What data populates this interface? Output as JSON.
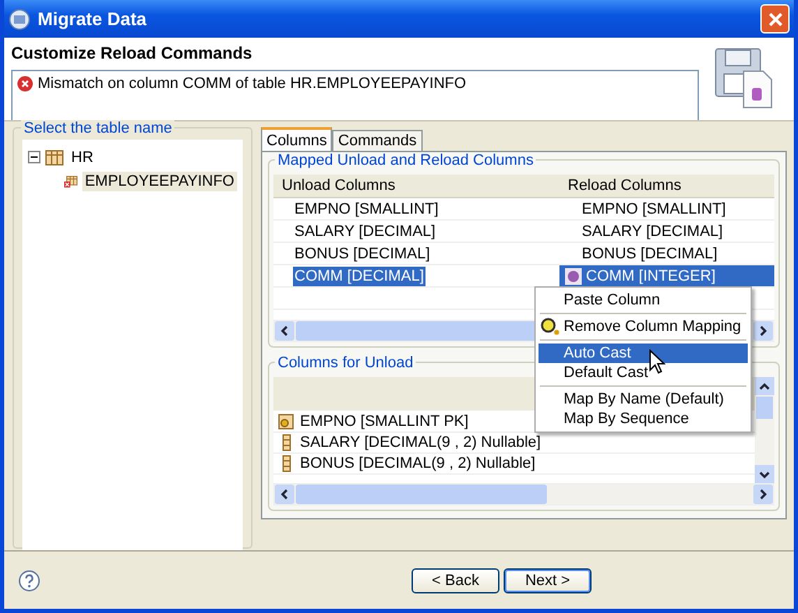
{
  "window": {
    "title": "Migrate Data"
  },
  "header": {
    "title": "Customize Reload Commands",
    "message": "Mismatch on column COMM of table HR.EMPLOYEEPAYINFO"
  },
  "tree": {
    "label": "Select the table name",
    "nodes": [
      {
        "label": "HR",
        "expanded": true,
        "error": false,
        "selected": false,
        "children": [
          {
            "label": "EMPLOYEEPAYINFO",
            "error": true,
            "selected": true
          }
        ]
      }
    ]
  },
  "tabs": [
    {
      "label": "Columns",
      "selected": true
    },
    {
      "label": "Commands",
      "selected": false
    }
  ],
  "mapped": {
    "label": "Mapped Unload and Reload Columns",
    "columns": [
      "Unload Columns",
      "Reload Columns"
    ],
    "rows": [
      {
        "unload": "EMPNO [SMALLINT]",
        "reload": "EMPNO [SMALLINT]",
        "selected": false,
        "warning": false
      },
      {
        "unload": "SALARY [DECIMAL]",
        "reload": "SALARY [DECIMAL]",
        "selected": false,
        "warning": false
      },
      {
        "unload": "BONUS [DECIMAL]",
        "reload": "BONUS [DECIMAL]",
        "selected": false,
        "warning": false
      },
      {
        "unload": "COMM [DECIMAL]",
        "reload": "COMM [INTEGER]",
        "selected": true,
        "warning": true
      }
    ]
  },
  "menu": [
    [
      {
        "label": "Paste Column",
        "kind": "text",
        "selected": false
      }
    ],
    [
      {
        "label": "Remove Column Mapping",
        "kind": "icon",
        "selected": false
      }
    ],
    [
      {
        "label": "Auto Cast",
        "kind": "text",
        "selected": true
      },
      {
        "label": "Default Cast",
        "kind": "text",
        "selected": false
      }
    ],
    [
      {
        "label": "Map By Name (Default)",
        "kind": "text",
        "selected": false
      },
      {
        "label": "Map By Sequence",
        "kind": "text",
        "selected": false
      }
    ]
  ],
  "unload": {
    "label": "Columns for Unload",
    "items": [
      {
        "label": "EMPNO [SMALLINT PK]",
        "kind": "key"
      },
      {
        "label": "SALARY [DECIMAL(9 , 2) Nullable]",
        "kind": "column"
      },
      {
        "label": "BONUS [DECIMAL(9 , 2) Nullable]",
        "kind": "column"
      }
    ]
  },
  "buttons": [
    {
      "label": "< Back",
      "default": false
    },
    {
      "label": "Next >",
      "default": true
    }
  ]
}
